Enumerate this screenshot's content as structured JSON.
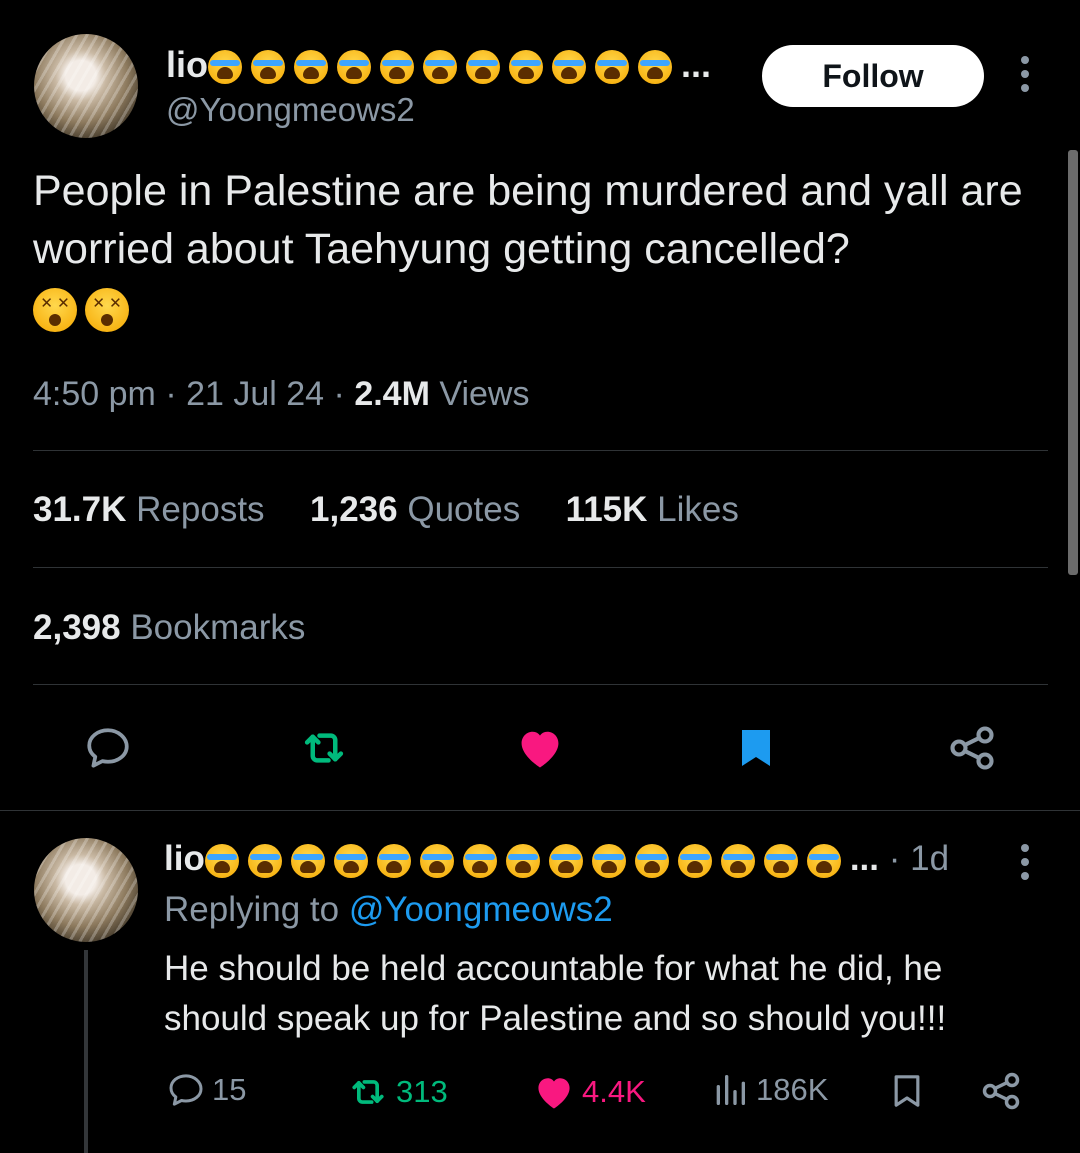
{
  "tweet": {
    "author": {
      "display_name": "lio",
      "emoji_count": 11,
      "handle": "@Yoongmeows2",
      "truncation": "..."
    },
    "follow_label": "Follow",
    "text": "People in Palestine are being murdered and yall are worried about Taehyung getting cancelled?",
    "trailing_emoji": [
      "dizzy-face-emoji",
      "dizzy-face-emoji"
    ],
    "time": "4:50 pm",
    "date": "21 Jul 24",
    "views_count": "2.4M",
    "views_label": "Views",
    "separator": "·",
    "stats": {
      "reposts_count": "31.7K",
      "reposts_label": "Reposts",
      "quotes_count": "1,236",
      "quotes_label": "Quotes",
      "likes_count": "115K",
      "likes_label": "Likes",
      "bookmarks_count": "2,398",
      "bookmarks_label": "Bookmarks"
    },
    "action_icons": [
      "reply-icon",
      "repost-icon",
      "like-icon",
      "bookmark-icon",
      "share-icon"
    ]
  },
  "reply": {
    "author": {
      "display_name": "lio",
      "emoji_count": 15,
      "truncation": "..."
    },
    "age": "1d",
    "replying_to_label": "Replying to",
    "replying_to_handle": "@Yoongmeows2",
    "text_line1": "He should be held accountable for what he did, he",
    "text_line2": "should speak up for Palestine and so should you!!!",
    "stats": {
      "replies": "15",
      "reposts": "313",
      "likes": "4.4K",
      "views": "186K"
    }
  },
  "colors": {
    "background": "#000000",
    "text_primary": "#e7e9ea",
    "text_secondary": "#8b98a5",
    "link": "#1d9bf0",
    "repost_green": "#00ba7c",
    "like_pink": "#f91880",
    "bookmark_blue": "#1d9bf0"
  }
}
